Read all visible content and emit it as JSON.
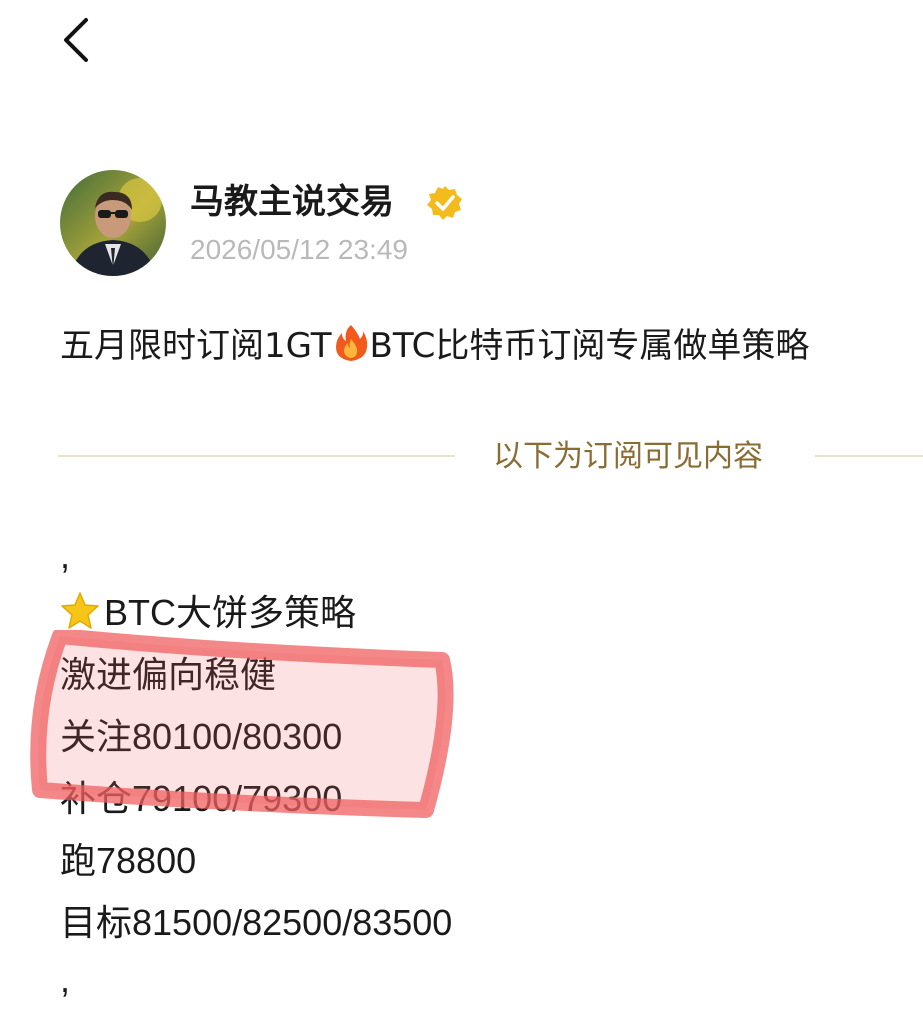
{
  "header": {
    "back_icon": "chevron-left-icon"
  },
  "author": {
    "name": "马教主说交易",
    "verified_icon": "verified-badge-icon",
    "verified_color": "#f3bb1c",
    "time": "2026/05/12 23:49"
  },
  "post": {
    "title_part1": "五月限时订阅1GT",
    "title_icon": "fire-icon",
    "title_part2": "BTC比特币订阅专属做单策略"
  },
  "divider": {
    "label": "以下为订阅可见内容",
    "accent_color": "#8a6d33"
  },
  "content": {
    "comma_top": ",",
    "star_icon": "star-icon",
    "strategy_title": "BTC大饼多策略",
    "line_risk": "激进偏向稳健",
    "line_watch": "关注80100/80300",
    "line_add": "补仓79100/79300",
    "line_stop": "跑78800",
    "line_target": "目标81500/82500/83500",
    "comma_bottom": ","
  },
  "annotation": {
    "highlight_color": "#f06060"
  }
}
